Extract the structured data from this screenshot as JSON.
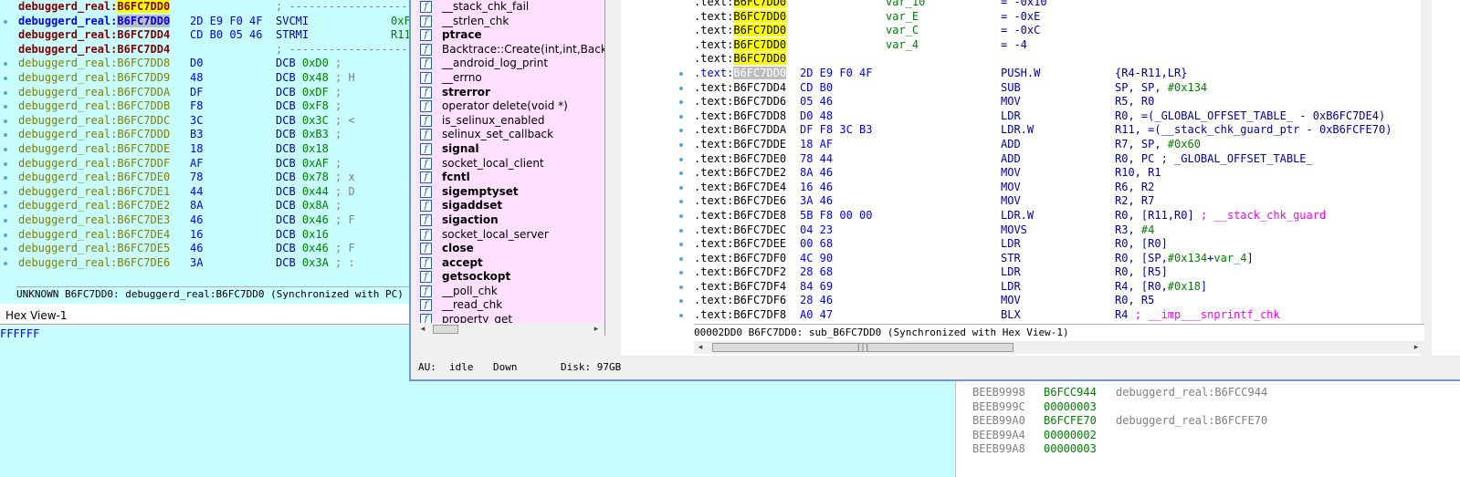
{
  "left_disasm": {
    "lines": [
      {
        "type": "code",
        "bullet": false,
        "seg": "debuggerd_real:",
        "addr": "B6FC7DD0",
        "addr_style": "red-yellow",
        "rest": "; ---------------------------------------"
      },
      {
        "type": "code",
        "bullet": true,
        "seg": "debuggerd_real:",
        "addr": "B6FC7DD0",
        "addr_style": "blue-grey",
        "bytes": "2D E9 F0 4F",
        "mn": "SVCMI",
        "op": "0xF"
      },
      {
        "type": "code",
        "bullet": false,
        "seg": "debuggerd_real:",
        "addr": "B6FC7DD4",
        "addr_style": "red",
        "bytes": "CD B0 05 46",
        "mn": "STRMI",
        "op": "R11"
      },
      {
        "type": "code",
        "bullet": false,
        "seg": "debuggerd_real:",
        "addr": "B6FC7DD4",
        "addr_style": "red",
        "rest": "; ---------------------------------------"
      },
      {
        "type": "data",
        "seg": "debuggerd_real:",
        "addr": "B6FC7DD8",
        "byte": "D0",
        "dcb": "0xD0",
        "cmt": ";"
      },
      {
        "type": "data",
        "seg": "debuggerd_real:",
        "addr": "B6FC7DD9",
        "byte": "48",
        "dcb": "0x48",
        "cmt": "; H"
      },
      {
        "type": "data",
        "seg": "debuggerd_real:",
        "addr": "B6FC7DDA",
        "byte": "DF",
        "dcb": "0xDF",
        "cmt": ";"
      },
      {
        "type": "data",
        "seg": "debuggerd_real:",
        "addr": "B6FC7DDB",
        "byte": "F8",
        "dcb": "0xF8",
        "cmt": ";"
      },
      {
        "type": "data",
        "seg": "debuggerd_real:",
        "addr": "B6FC7DDC",
        "byte": "3C",
        "dcb": "0x3C",
        "cmt": "; <"
      },
      {
        "type": "data",
        "seg": "debuggerd_real:",
        "addr": "B6FC7DDD",
        "byte": "B3",
        "dcb": "0xB3",
        "cmt": ";"
      },
      {
        "type": "data",
        "seg": "debuggerd_real:",
        "addr": "B6FC7DDE",
        "byte": "18",
        "dcb": "0x18",
        "cmt": ""
      },
      {
        "type": "data",
        "seg": "debuggerd_real:",
        "addr": "B6FC7DDF",
        "byte": "AF",
        "dcb": "0xAF",
        "cmt": ";"
      },
      {
        "type": "data",
        "seg": "debuggerd_real:",
        "addr": "B6FC7DE0",
        "byte": "78",
        "dcb": "0x78",
        "cmt": "; x"
      },
      {
        "type": "data",
        "seg": "debuggerd_real:",
        "addr": "B6FC7DE1",
        "byte": "44",
        "dcb": "0x44",
        "cmt": "; D"
      },
      {
        "type": "data",
        "seg": "debuggerd_real:",
        "addr": "B6FC7DE2",
        "byte": "8A",
        "dcb": "0x8A",
        "cmt": ";"
      },
      {
        "type": "data",
        "seg": "debuggerd_real:",
        "addr": "B6FC7DE3",
        "byte": "46",
        "dcb": "0x46",
        "cmt": "; F"
      },
      {
        "type": "data",
        "seg": "debuggerd_real:",
        "addr": "B6FC7DE4",
        "byte": "16",
        "dcb": "0x16",
        "cmt": ""
      },
      {
        "type": "data",
        "seg": "debuggerd_real:",
        "addr": "B6FC7DE5",
        "byte": "46",
        "dcb": "0x46",
        "cmt": "; F"
      },
      {
        "type": "data",
        "seg": "debuggerd_real:",
        "addr": "B6FC7DE6",
        "byte": "3A",
        "dcb": "0x3A",
        "cmt": "; :"
      }
    ],
    "dcb_keyword": "DCB",
    "status": "UNKNOWN B6FC7DD0: debuggerd_real:B6FC7DD0 (Synchronized with PC)"
  },
  "hex_view": {
    "title": "Hex View-1",
    "content": "FFFFFF"
  },
  "functions": {
    "icon_label": "f",
    "items": [
      {
        "name": "__stack_chk_fail",
        "bold": false
      },
      {
        "name": "__strlen_chk",
        "bold": false
      },
      {
        "name": "ptrace",
        "bold": true
      },
      {
        "name": "Backtrace::Create(int,int,Backtrace",
        "bold": false
      },
      {
        "name": "__android_log_print",
        "bold": false
      },
      {
        "name": "__errno",
        "bold": false
      },
      {
        "name": "strerror",
        "bold": true
      },
      {
        "name": "operator delete(void *)",
        "bold": false
      },
      {
        "name": "is_selinux_enabled",
        "bold": false
      },
      {
        "name": "selinux_set_callback",
        "bold": false
      },
      {
        "name": "signal",
        "bold": true
      },
      {
        "name": "socket_local_client",
        "bold": false
      },
      {
        "name": "fcntl",
        "bold": true
      },
      {
        "name": "sigemptyset",
        "bold": true
      },
      {
        "name": "sigaddset",
        "bold": true
      },
      {
        "name": "sigaction",
        "bold": true
      },
      {
        "name": "socket_local_server",
        "bold": false
      },
      {
        "name": "close",
        "bold": true
      },
      {
        "name": "accept",
        "bold": true
      },
      {
        "name": "getsockopt",
        "bold": true
      },
      {
        "name": "__poll_chk",
        "bold": false
      },
      {
        "name": "__read_chk",
        "bold": false
      },
      {
        "name": "property_get",
        "bold": false
      }
    ]
  },
  "ida_view": {
    "seg": ".text:",
    "var_lines": [
      {
        "addr": "B6FC7DD0",
        "name": "var_10",
        "val": "= -0x10"
      },
      {
        "addr": "B6FC7DD0",
        "name": "var_E",
        "val": "= -0xE"
      },
      {
        "addr": "B6FC7DD0",
        "name": "var_C",
        "val": "= -0xC"
      },
      {
        "addr": "B6FC7DD0",
        "name": "var_4",
        "val": "= -4"
      },
      {
        "addr": "B6FC7DD0",
        "name": "",
        "val": ""
      }
    ],
    "code_lines": [
      {
        "addr": "B6FC7DD0",
        "hl": true,
        "bytes": "2D E9 F0 4F",
        "mn": "PUSH.W",
        "ops": [
          {
            "t": "{R4-R11,LR}",
            "c": "kw"
          }
        ]
      },
      {
        "addr": "B6FC7DD4",
        "bytes": "CD B0",
        "mn": "SUB",
        "ops": [
          {
            "t": "SP, SP, ",
            "c": "kw"
          },
          {
            "t": "#0x134",
            "c": "num"
          }
        ]
      },
      {
        "addr": "B6FC7DD6",
        "bytes": "05 46",
        "mn": "MOV",
        "ops": [
          {
            "t": "R5, R0",
            "c": "kw"
          }
        ]
      },
      {
        "addr": "B6FC7DD8",
        "bytes": "D0 48",
        "mn": "LDR",
        "ops": [
          {
            "t": "R0, =(_GLOBAL_OFFSET_TABLE_ - 0xB6FC7DE4)",
            "c": "kw"
          }
        ]
      },
      {
        "addr": "B6FC7DDA",
        "bytes": "DF F8 3C B3",
        "mn": "LDR.W",
        "ops": [
          {
            "t": "R11, =(__stack_chk_guard_ptr - 0xB6FCFE70)",
            "c": "kw"
          }
        ]
      },
      {
        "addr": "B6FC7DDE",
        "bytes": "18 AF",
        "mn": "ADD",
        "ops": [
          {
            "t": "R7, SP, ",
            "c": "kw"
          },
          {
            "t": "#0x60",
            "c": "num"
          }
        ]
      },
      {
        "addr": "B6FC7DE0",
        "bytes": "78 44",
        "mn": "ADD",
        "ops": [
          {
            "t": "R0, PC ",
            "c": "kw"
          },
          {
            "t": "; _GLOBAL_OFFSET_TABLE_",
            "c": "kw"
          }
        ]
      },
      {
        "addr": "B6FC7DE2",
        "bytes": "8A 46",
        "mn": "MOV",
        "ops": [
          {
            "t": "R10, R1",
            "c": "kw"
          }
        ]
      },
      {
        "addr": "B6FC7DE4",
        "bytes": "16 46",
        "mn": "MOV",
        "ops": [
          {
            "t": "R6, R2",
            "c": "kw"
          }
        ]
      },
      {
        "addr": "B6FC7DE6",
        "bytes": "3A 46",
        "mn": "MOV",
        "ops": [
          {
            "t": "R2, R7",
            "c": "kw"
          }
        ]
      },
      {
        "addr": "B6FC7DE8",
        "bytes": "5B F8 00 00",
        "mn": "LDR.W",
        "ops": [
          {
            "t": "R0, [R11,R0] ",
            "c": "kw"
          },
          {
            "t": "; __stack_chk_guard",
            "c": "pink"
          }
        ]
      },
      {
        "addr": "B6FC7DEC",
        "bytes": "04 23",
        "mn": "MOVS",
        "ops": [
          {
            "t": "R3, ",
            "c": "kw"
          },
          {
            "t": "#4",
            "c": "num"
          }
        ]
      },
      {
        "addr": "B6FC7DEE",
        "bytes": "00 68",
        "mn": "LDR",
        "ops": [
          {
            "t": "R0, [R0]",
            "c": "kw"
          }
        ]
      },
      {
        "addr": "B6FC7DF0",
        "bytes": "4C 90",
        "mn": "STR",
        "ops": [
          {
            "t": "R0, [SP,",
            "c": "kw"
          },
          {
            "t": "#0x134",
            "c": "num"
          },
          {
            "t": "+",
            "c": "kw"
          },
          {
            "t": "var_4",
            "c": "num"
          },
          {
            "t": "]",
            "c": "kw"
          }
        ]
      },
      {
        "addr": "B6FC7DF2",
        "bytes": "28 68",
        "mn": "LDR",
        "ops": [
          {
            "t": "R0, [R5]",
            "c": "kw"
          }
        ]
      },
      {
        "addr": "B6FC7DF4",
        "bytes": "84 69",
        "mn": "LDR",
        "ops": [
          {
            "t": "R4, [R0,",
            "c": "kw"
          },
          {
            "t": "#0x18",
            "c": "num"
          },
          {
            "t": "]",
            "c": "kw"
          }
        ]
      },
      {
        "addr": "B6FC7DF6",
        "bytes": "28 46",
        "mn": "MOV",
        "ops": [
          {
            "t": "R0, R5",
            "c": "kw"
          }
        ]
      },
      {
        "addr": "B6FC7DF8",
        "bytes": "A0 47",
        "mn": "BLX",
        "ops": [
          {
            "t": "R4 ",
            "c": "kw"
          },
          {
            "t": "; __imp___snprintf_chk",
            "c": "pink"
          }
        ]
      }
    ],
    "status": "00002DD0 B6FC7DD0: sub_B6FC7DD0 (Synchronized with Hex View-1)",
    "thumb_label": "|||"
  },
  "bottom_status": {
    "au_label": "AU:",
    "au_value": "idle",
    "direction": "Down",
    "disk": "Disk: 97GB"
  },
  "stack_view": {
    "lines": [
      {
        "addr": "BEEB9998",
        "val": "B6FCC944",
        "ref": "debuggerd_real:B6FCC944"
      },
      {
        "addr": "BEEB999C",
        "val": "00000003",
        "ref": ""
      },
      {
        "addr": "BEEB99A0",
        "val": "B6FCFE70",
        "ref": "debuggerd_real:B6FCFE70"
      },
      {
        "addr": "BEEB99A4",
        "val": "00000002",
        "ref": ""
      },
      {
        "addr": "BEEB99A8",
        "val": "00000003",
        "ref": ""
      }
    ]
  },
  "colors": {
    "left_bg": "#c8fefe",
    "func_bg": "#ffe0ff",
    "highlight": "#ffff00",
    "code_blue": "#0000aa",
    "num_green": "#008000",
    "pink": "#ff00ff"
  }
}
